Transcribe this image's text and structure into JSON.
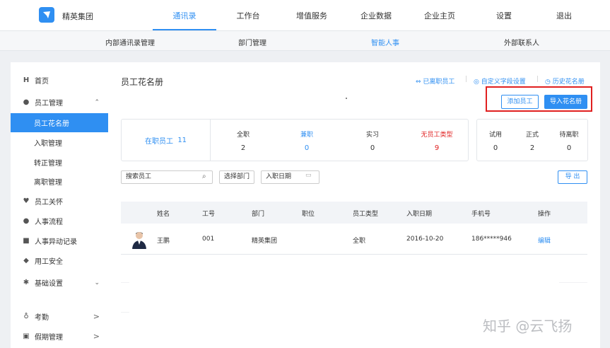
{
  "header": {
    "brand": "精英集团",
    "nav": [
      "通讯录",
      "工作台",
      "增值服务",
      "企业数据",
      "企业主页",
      "设置",
      "退出"
    ],
    "active_nav": "通讯录"
  },
  "subnav": {
    "items": [
      "内部通讯录管理",
      "部门管理",
      "智能人事",
      "外部联系人"
    ],
    "active": "智能人事"
  },
  "sidebar": {
    "items": [
      {
        "label": "首页",
        "icon": "home-icon"
      },
      {
        "label": "员工管理",
        "icon": "users-icon"
      },
      {
        "label": "员工花名册",
        "active": true
      },
      {
        "label": "入职管理"
      },
      {
        "label": "转正管理"
      },
      {
        "label": "离职管理"
      },
      {
        "label": "员工关怀",
        "icon": "heart-icon"
      },
      {
        "label": "人事流程",
        "icon": "person-icon"
      },
      {
        "label": "人事异动记录",
        "icon": "file-icon"
      },
      {
        "label": "用工安全",
        "icon": "shield-icon"
      },
      {
        "label": "基础设置",
        "icon": "gear-icon"
      },
      {
        "label": "考勤",
        "icon": "location-icon"
      },
      {
        "label": "假期管理",
        "icon": "calendar-icon"
      }
    ]
  },
  "main": {
    "title": "员工花名册",
    "links": [
      "已离职员工",
      "自定义字段设置",
      "历史花名册"
    ],
    "add_button": "添加员工",
    "import_button": "导入花名册",
    "export_button": "导 出",
    "stats": {
      "active_label": "在职员工",
      "active_count": "11",
      "types": [
        {
          "label": "全职",
          "value": "2"
        },
        {
          "label": "兼职",
          "value": "0"
        },
        {
          "label": "实习",
          "value": "0"
        },
        {
          "label": "无员工类型",
          "value": "9"
        }
      ],
      "status": [
        {
          "label": "试用",
          "value": "0"
        },
        {
          "label": "正式",
          "value": "2"
        },
        {
          "label": "待离职",
          "value": "0"
        }
      ]
    },
    "filters": {
      "search_placeholder": "搜索员工",
      "dept_button": "选择部门",
      "date_placeholder": "入职日期"
    },
    "table": {
      "columns": [
        "姓名",
        "工号",
        "部门",
        "职位",
        "员工类型",
        "入职日期",
        "手机号",
        "操作"
      ],
      "rows": [
        {
          "name": "王鹏",
          "id": "001",
          "dept": "精英集团",
          "position": "",
          "type": "全职",
          "date": "2016-10-20",
          "phone": "186*****946",
          "action": "编辑"
        }
      ]
    }
  },
  "watermark": "知乎 @云飞扬",
  "colors": {
    "accent": "#2f8ff2",
    "alert": "#e02020"
  }
}
